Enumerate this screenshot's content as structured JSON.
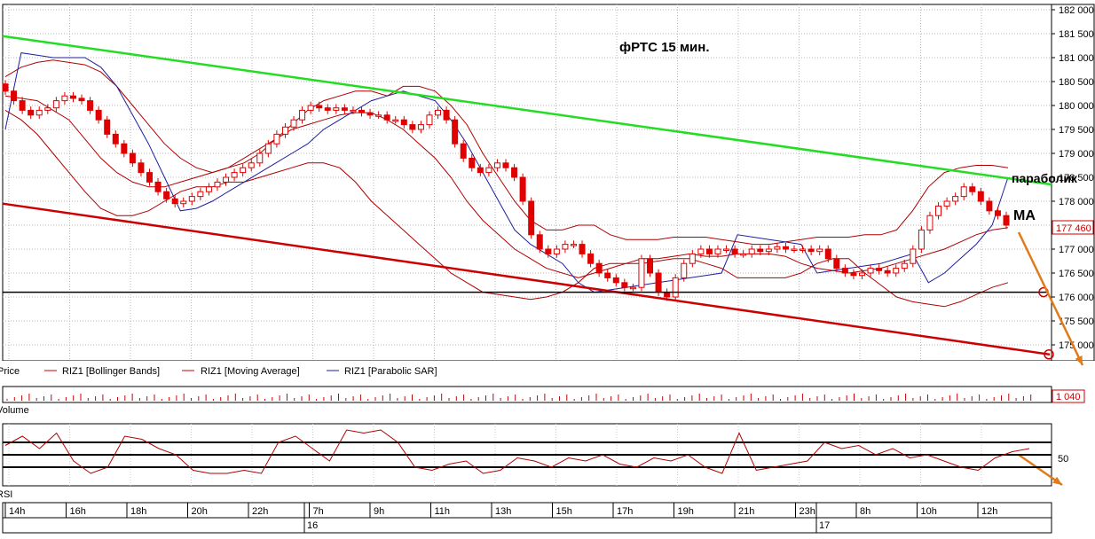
{
  "title": "фРТС  15 мин.",
  "annotations": {
    "parabolic": "параболик",
    "ma": "МА"
  },
  "price_panel": {
    "legend": [
      {
        "label": "Price",
        "color": "#cc0000"
      },
      {
        "label": "RIZ1 [Bollinger Bands]",
        "color": "#cc0000"
      },
      {
        "label": "RIZ1 [Moving Average]",
        "color": "#cc0000"
      },
      {
        "label": "RIZ1 [Parabolic SAR]",
        "color": "#1f1f9e"
      }
    ],
    "last_price_label": "177 460"
  },
  "volume_panel": {
    "title": "Volume",
    "last_label": "1 040"
  },
  "rsi_panel": {
    "title": "RSI",
    "level_label": "50"
  },
  "time_axis": {
    "hour_labels": [
      "14h",
      "16h",
      "18h",
      "20h",
      "22h",
      "7h",
      "9h",
      "11h",
      "13h",
      "15h",
      "17h",
      "19h",
      "21h",
      "23h",
      "8h",
      "10h",
      "12h"
    ],
    "day_labels": [
      "16",
      "17"
    ]
  },
  "colors": {
    "candle": "#e00000",
    "bollinger": "#b00000",
    "moving_average": "#b00000",
    "parabolic_sar": "#1f1f9e",
    "upper_trendline": "#22dd22",
    "lower_trendline": "#cc0000",
    "support_line": "#000000",
    "forecast_arrow": "#e07a1a"
  },
  "chart_data": {
    "type": "line",
    "y_axis": {
      "ticks": [
        175000,
        175500,
        176000,
        176500,
        177000,
        177500,
        178000,
        178500,
        179000,
        179500,
        180000,
        180500,
        181000,
        181500,
        182000
      ],
      "tick_labels": [
        "175 000",
        "175 500",
        "176 000",
        "176 500",
        "177 000",
        "177 500",
        "178 000",
        "178 500",
        "179 000",
        "179 500",
        "180 000",
        "180 500",
        "181 000",
        "181 500",
        "182 000"
      ],
      "range": [
        174750,
        182050
      ]
    },
    "close": [
      180300,
      180100,
      179900,
      179800,
      179900,
      179950,
      180100,
      180200,
      180150,
      180100,
      179900,
      179700,
      179400,
      179200,
      179000,
      178800,
      178600,
      178400,
      178200,
      178050,
      177950,
      178000,
      178100,
      178200,
      178300,
      178400,
      178500,
      178600,
      178700,
      178800,
      179000,
      179200,
      179400,
      179550,
      179700,
      179900,
      180000,
      179950,
      179900,
      179950,
      179900,
      179900,
      179850,
      179800,
      179800,
      179700,
      179700,
      179600,
      179500,
      179600,
      179800,
      179900,
      179700,
      179200,
      178900,
      178700,
      178600,
      178700,
      178800,
      178700,
      178500,
      178000,
      177300,
      177000,
      176900,
      177000,
      177100,
      177100,
      176900,
      176700,
      176500,
      176400,
      176300,
      176200,
      176200,
      176800,
      176500,
      176100,
      176000,
      176400,
      176700,
      176900,
      177000,
      176900,
      177000,
      177000,
      176900,
      176900,
      177000,
      176950,
      177000,
      177050,
      177000,
      177000,
      177000,
      176950,
      177000,
      176800,
      176600,
      176500,
      176450,
      176500,
      176600,
      176550,
      176500,
      176600,
      176700,
      177000,
      177400,
      177700,
      177900,
      178000,
      178100,
      178300,
      178200,
      178000,
      177800,
      177700,
      177500
    ],
    "bollinger_upper": [
      180600,
      180800,
      180900,
      180950,
      180900,
      180850,
      180700,
      180400,
      180000,
      179600,
      179200,
      178900,
      178700,
      178600,
      178700,
      178800,
      179000,
      179300,
      179600,
      179900,
      180100,
      180200,
      180300,
      180300,
      180200,
      180400,
      180400,
      180300,
      180000,
      179600,
      179000,
      178500,
      178000,
      177600,
      177400,
      177400,
      177500,
      177500,
      177300,
      177200,
      177200,
      177200,
      177250,
      177250,
      177250,
      177200,
      177150,
      177100,
      177100,
      177150,
      177200,
      177250,
      177250,
      177250,
      177300,
      177300,
      177400,
      177800,
      178300,
      178600,
      178700,
      178750,
      178750,
      178700
    ],
    "bollinger_lower": [
      179900,
      179700,
      179400,
      179000,
      178600,
      178200,
      177850,
      177700,
      177700,
      177800,
      178000,
      178200,
      178300,
      178300,
      178400,
      178400,
      178500,
      178600,
      178700,
      178800,
      178800,
      178700,
      178400,
      178000,
      177700,
      177400,
      177100,
      176800,
      176500,
      176300,
      176100,
      176050,
      176000,
      175950,
      176000,
      176100,
      176300,
      176600,
      176700,
      176700,
      176700,
      176750,
      176800,
      176800,
      176700,
      176600,
      176400,
      176400,
      176400,
      176400,
      176500,
      176700,
      176800,
      176800,
      176500,
      176250,
      176000,
      175900,
      175850,
      175800,
      175900,
      176050,
      176200,
      176300
    ],
    "moving_average": [
      180200,
      180150,
      180100,
      179900,
      179700,
      179300,
      178900,
      178600,
      178400,
      178300,
      178300,
      178400,
      178500,
      178600,
      178700,
      178900,
      179100,
      179300,
      179500,
      179600,
      179700,
      179800,
      179850,
      179850,
      179700,
      179500,
      179200,
      178900,
      178500,
      178000,
      177600,
      177300,
      177000,
      176800,
      176600,
      176500,
      176400,
      176500,
      176600,
      176700,
      176800,
      176800,
      176850,
      176900,
      176850,
      176850,
      176900,
      176900,
      176900,
      176850,
      176700,
      176600,
      176550,
      176500,
      176550,
      176600,
      176700,
      176800,
      176900,
      177000,
      177150,
      177300,
      177400,
      177450
    ],
    "parabolic_sar": [
      179500,
      181100,
      181050,
      181000,
      181000,
      181000,
      180800,
      180400,
      179800,
      179200,
      178500,
      177800,
      177850,
      178000,
      178200,
      178400,
      178600,
      178800,
      179000,
      179200,
      179500,
      179700,
      179900,
      180100,
      180200,
      180300,
      180200,
      180100,
      179700,
      179200,
      178600,
      178000,
      177400,
      177100,
      176900,
      176700,
      176300,
      176100,
      176150,
      176200,
      176250,
      176300,
      176350,
      176400,
      176450,
      176500,
      177300,
      177250,
      177200,
      177150,
      177100,
      176500,
      176550,
      176600,
      176650,
      176700,
      176800,
      176900,
      176300,
      176500,
      176800,
      177100,
      177500,
      178500
    ],
    "volume_last": 1040,
    "rsi": [
      65,
      80,
      60,
      85,
      40,
      20,
      30,
      80,
      75,
      60,
      50,
      25,
      20,
      20,
      25,
      20,
      70,
      80,
      60,
      40,
      90,
      85,
      90,
      70,
      30,
      25,
      35,
      40,
      20,
      25,
      45,
      40,
      30,
      45,
      40,
      50,
      35,
      30,
      45,
      40,
      50,
      30,
      20,
      85,
      25,
      30,
      35,
      40,
      70,
      60,
      65,
      50,
      60,
      45,
      50,
      40,
      30,
      25,
      45,
      55,
      60
    ],
    "rsi_levels": [
      30,
      50,
      70
    ],
    "trendlines": {
      "upper": {
        "from": 181450,
        "to": 178350
      },
      "lower": {
        "from": 177950,
        "to": 174800
      },
      "support": 176100
    }
  }
}
